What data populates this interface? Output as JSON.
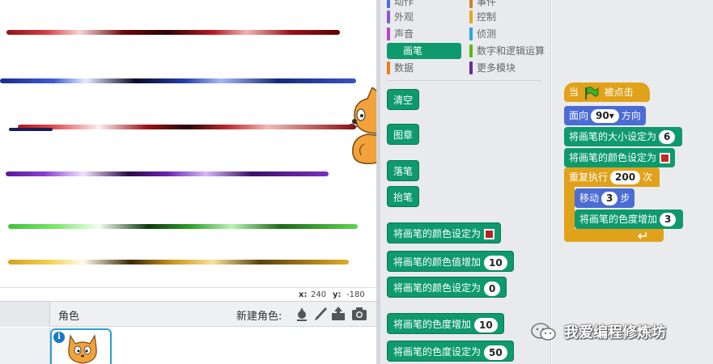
{
  "stage": {
    "coords": {
      "x_label": "x:",
      "x_value": "240",
      "y_label": "y:",
      "y_value": "-180"
    }
  },
  "sprites": {
    "title": "角色",
    "new_sprite_label": "新建角色:"
  },
  "categories": {
    "motion": "动作",
    "looks": "外观",
    "sound": "声音",
    "pen": "画笔",
    "data": "数据",
    "events": "事件",
    "control": "控制",
    "sensing": "侦测",
    "operators": "数字和逻辑运算",
    "more": "更多模块"
  },
  "palette": {
    "clear": "清空",
    "stamp": "图章",
    "pen_down": "落笔",
    "pen_up": "抬笔",
    "set_color_to": "将画笔的颜色设定为",
    "change_color_by": "将画笔的颜色值增加",
    "change_color_by_value": "10",
    "set_color_value_to": "将画笔的颜色设定为",
    "set_color_value_to_value": "0",
    "change_shade_by": "将画笔的色度增加",
    "change_shade_by_value": "10",
    "set_shade_to": "将画笔的色度设定为",
    "set_shade_to_value": "50"
  },
  "script": {
    "when_flag_prefix": "当",
    "when_flag_suffix": "被点击",
    "point_label": "面向",
    "point_value": "90▾",
    "point_suffix": "方向",
    "set_size_label": "将画笔的大小设定为",
    "set_size_value": "6",
    "set_color_label": "将画笔的颜色设定为",
    "repeat_label": "重复执行",
    "repeat_value": "200",
    "repeat_suffix": "次",
    "move_label": "移动",
    "move_value": "3",
    "move_suffix": "步",
    "change_shade_label": "将画笔的色度增加",
    "change_shade_value": "3"
  },
  "watermark": "我爱编程修炼坊",
  "colors": {
    "pen_green": "#0e9a6c",
    "motion_blue": "#4a6cd4",
    "control_orange": "#e0a21a",
    "pen_red": "#b3242a"
  }
}
